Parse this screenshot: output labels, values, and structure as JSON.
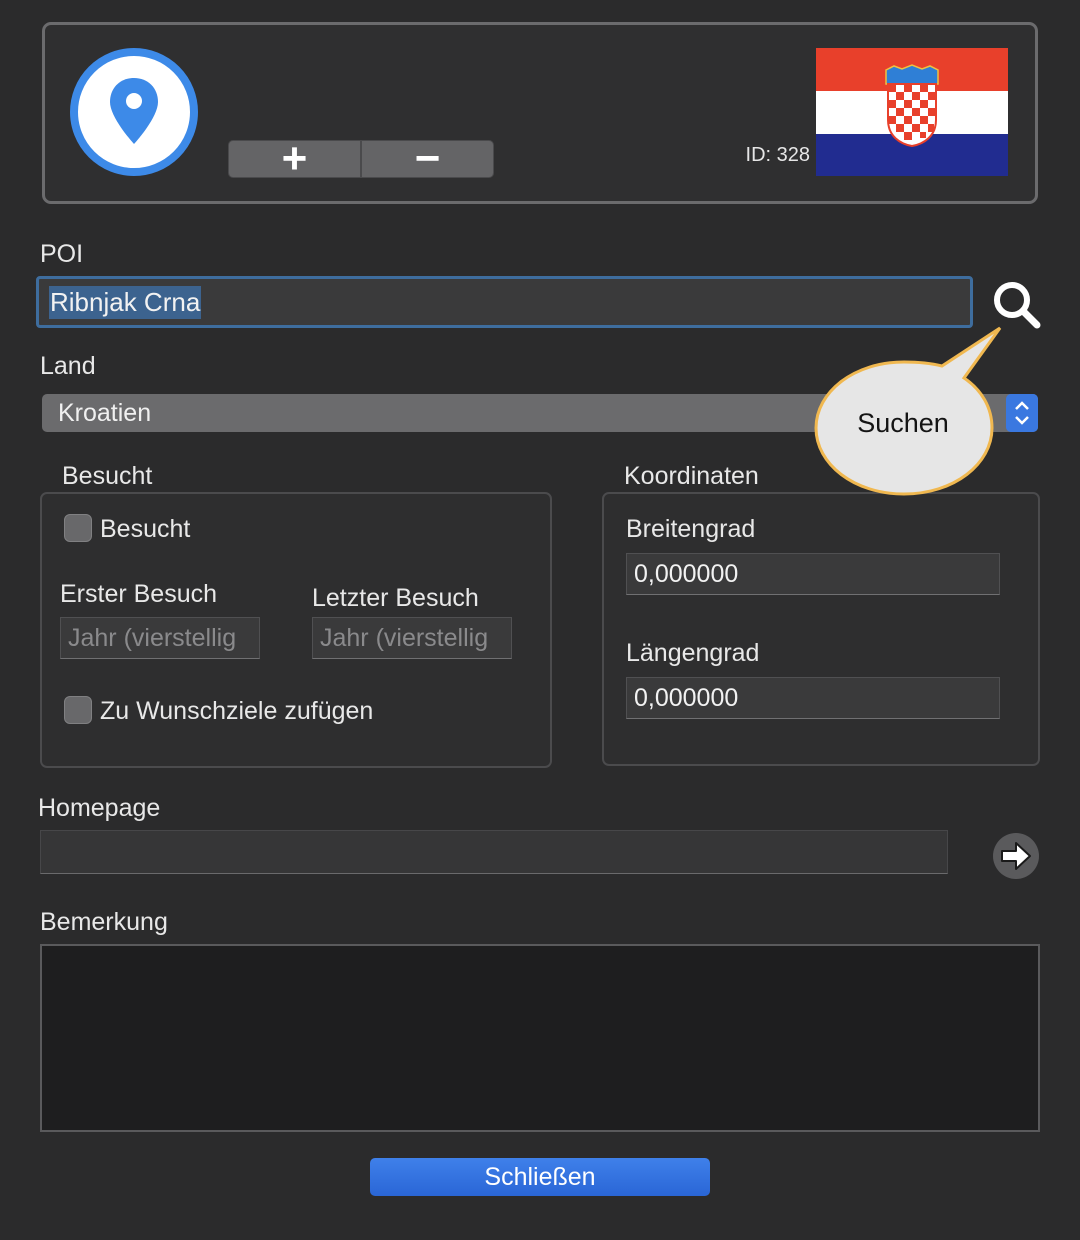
{
  "header": {
    "add_label": "+",
    "remove_label": "−",
    "id_label": "ID: 328",
    "app_icon": "map-pin-icon",
    "flag_icon": "croatia-flag-icon"
  },
  "poi": {
    "label": "POI",
    "value": "Ribnjak Crna",
    "search_icon": "search-icon"
  },
  "tooltip": {
    "text": "Suchen"
  },
  "land": {
    "label": "Land",
    "selected": "Kroatien"
  },
  "besucht": {
    "group_label": "Besucht",
    "checkbox_label": "Besucht",
    "erster_label": "Erster Besuch",
    "letzter_label": "Letzter Besuch",
    "erster_placeholder": "Jahr (vierstellig",
    "letzter_placeholder": "Jahr (vierstellig",
    "wunsch_label": "Zu Wunschziele zufügen"
  },
  "koordinaten": {
    "group_label": "Koordinaten",
    "breite_label": "Breitengrad",
    "breite_value": "0,000000",
    "laenge_label": "Längengrad",
    "laenge_value": "0,000000"
  },
  "homepage": {
    "label": "Homepage",
    "value": ""
  },
  "bemerkung": {
    "label": "Bemerkung",
    "value": ""
  },
  "footer": {
    "close_label": "Schließen"
  },
  "colors": {
    "accent": "#2f6fe0",
    "background": "#2b2b2c",
    "selection": "#3c638f",
    "tooltip_fill": "#e6e6e6",
    "tooltip_border": "#f0b850"
  }
}
